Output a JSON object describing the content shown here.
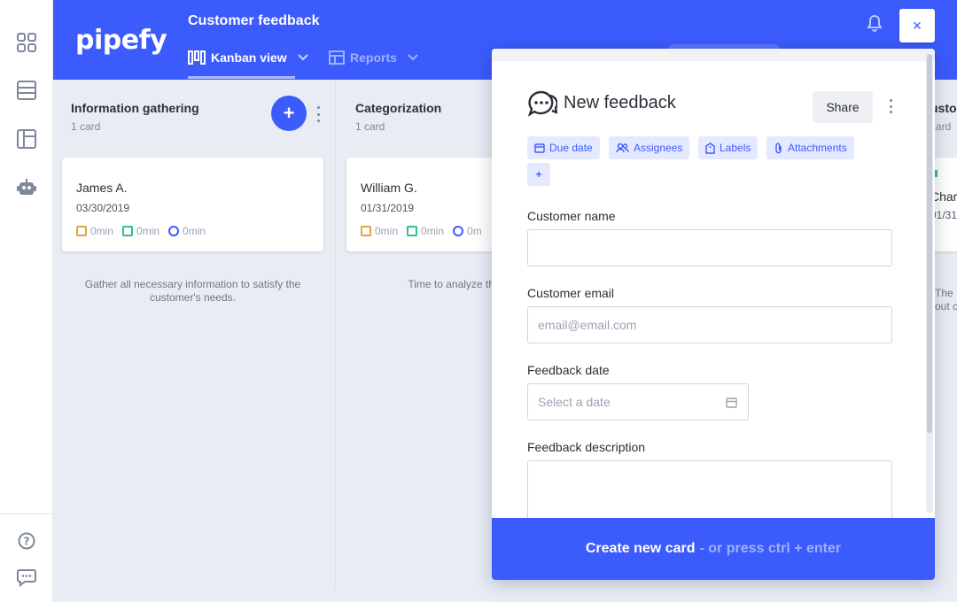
{
  "app": {
    "logo": "pipefy",
    "pipe_title": "Customer feedback"
  },
  "header": {
    "tabs": [
      {
        "label": "Kanban view",
        "icon": "kanban-icon",
        "active": true
      },
      {
        "label": "Reports",
        "icon": "reports-icon",
        "active": false
      }
    ]
  },
  "sidebar": {
    "items": [
      {
        "icon": "dashboard-icon"
      },
      {
        "icon": "database-icon"
      },
      {
        "icon": "layout-icon"
      },
      {
        "icon": "robot-icon"
      }
    ],
    "bottom": [
      {
        "icon": "help-icon"
      },
      {
        "icon": "chat-icon"
      }
    ]
  },
  "phases": [
    {
      "title": "Information gathering",
      "count": "1 card",
      "card": {
        "name": "James A.",
        "date": "03/30/2019",
        "timers": [
          "0min",
          "0min",
          "0min"
        ]
      },
      "description": "Gather all necessary information to satisfy the customer's needs."
    },
    {
      "title": "Categorization",
      "count": "1 card",
      "card": {
        "name": "William G.",
        "date": "01/31/2019",
        "timers": [
          "0min",
          "0min",
          "0m"
        ]
      },
      "description": "Time to analyze the categoriz"
    },
    {
      "title": "usto",
      "count": "card",
      "card": {
        "name": "Char",
        "date": "01/31"
      },
      "description": "The\nout c"
    }
  ],
  "modal": {
    "title": "New feedback",
    "share_label": "Share",
    "chips": [
      "Due date",
      "Assignees",
      "Labels",
      "Attachments"
    ],
    "add_chip": "+",
    "fields": {
      "customer_name": {
        "label": "Customer name",
        "placeholder": ""
      },
      "customer_email": {
        "label": "Customer email",
        "placeholder": "email@email.com"
      },
      "feedback_date": {
        "label": "Feedback date",
        "placeholder": "Select a date"
      },
      "feedback_description": {
        "label": "Feedback description",
        "placeholder": ""
      }
    },
    "create_label": "Create new card",
    "create_hint": "- or press ctrl + enter",
    "close_label": "×"
  },
  "colors": {
    "brand": "#3b5bfd",
    "timer_late": "#e6a23c",
    "timer_done": "#2ec08c"
  }
}
